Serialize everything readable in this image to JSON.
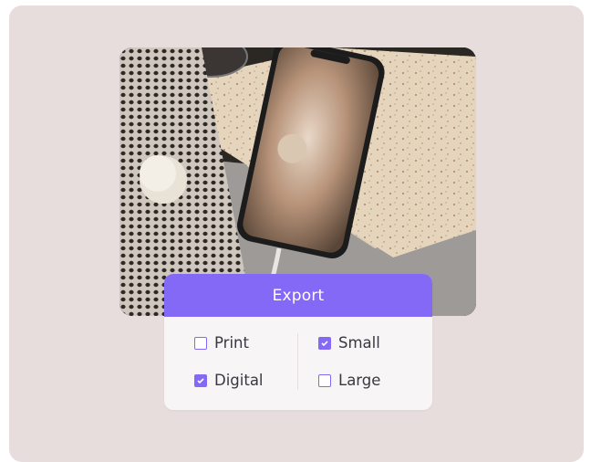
{
  "export": {
    "title": "Export",
    "accent_color": "#8468f6",
    "options": [
      {
        "label": "Print",
        "checked": false
      },
      {
        "label": "Digital",
        "checked": true
      },
      {
        "label": "Small",
        "checked": true
      },
      {
        "label": "Large",
        "checked": false
      }
    ]
  },
  "photo": {
    "description_icon": "phone-on-paper-photo"
  }
}
